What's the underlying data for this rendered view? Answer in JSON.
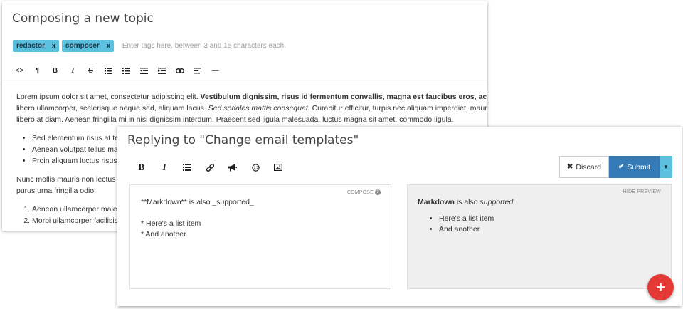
{
  "back": {
    "title": "Composing a new topic",
    "tags": [
      {
        "label": "redactor",
        "remove": "x"
      },
      {
        "label": "composer",
        "remove": "x"
      }
    ],
    "tags_placeholder": "Enter tags here, between 3 and 15 characters each.",
    "toolbar": [
      "<>",
      "¶",
      "B",
      "I",
      "S",
      "ul",
      "ol",
      "outdent",
      "indent",
      "link",
      "align",
      "—"
    ],
    "doc": {
      "p1_a": "Lorem ipsum dolor sit amet, consectetur adipiscing elit. ",
      "p1_b": "Vestibulum dignissim, risus id fermentum convallis, magna est faucibus eros, ac b",
      "p1_c": "libero ullamcorper, scelerisque neque sed, aliquam lacus. ",
      "p1_d": "Sed sodales mattis consequat.",
      "p1_e": " Curabitur efficitur, turpis nec aliquam imperdiet, mauris",
      "p1_f": "libero at diam. Aenean fringilla mi in nisl dignissim interdum. Praesent sed ligula malesuada, luctus magna sit amet, commodo ligula.",
      "bullets": [
        "Sed elementum risus at te",
        "Aenean volutpat tellus ma",
        "Proin aliquam luctus risus,"
      ],
      "p2_a": "Nunc mollis mauris non lectus",
      "p2_b": "purus urna fringilla odio.",
      "numbered": [
        "Aenean ullamcorper males",
        "Morbi ullamcorper facilisis"
      ]
    }
  },
  "front": {
    "title": "Replying to \"Change email templates\"",
    "discard_label": "Discard",
    "submit_label": "Submit",
    "compose_label": "COMPOSE",
    "compose_help": "?",
    "compose_text": "**Markdown** is also _supported_\n\n* Here's a list item\n* And another",
    "preview_label": "HIDE PREVIEW",
    "preview": {
      "strong": "Markdown",
      "middle": " is also ",
      "em": "supported",
      "items": [
        "Here's a list item",
        "And another"
      ]
    }
  },
  "fab_label": "+",
  "colors": {
    "tag": "#5bc0de",
    "submit": "#337ab7",
    "caret": "#5bc0de",
    "fab": "#e53935",
    "preview_bg": "#efefef"
  }
}
